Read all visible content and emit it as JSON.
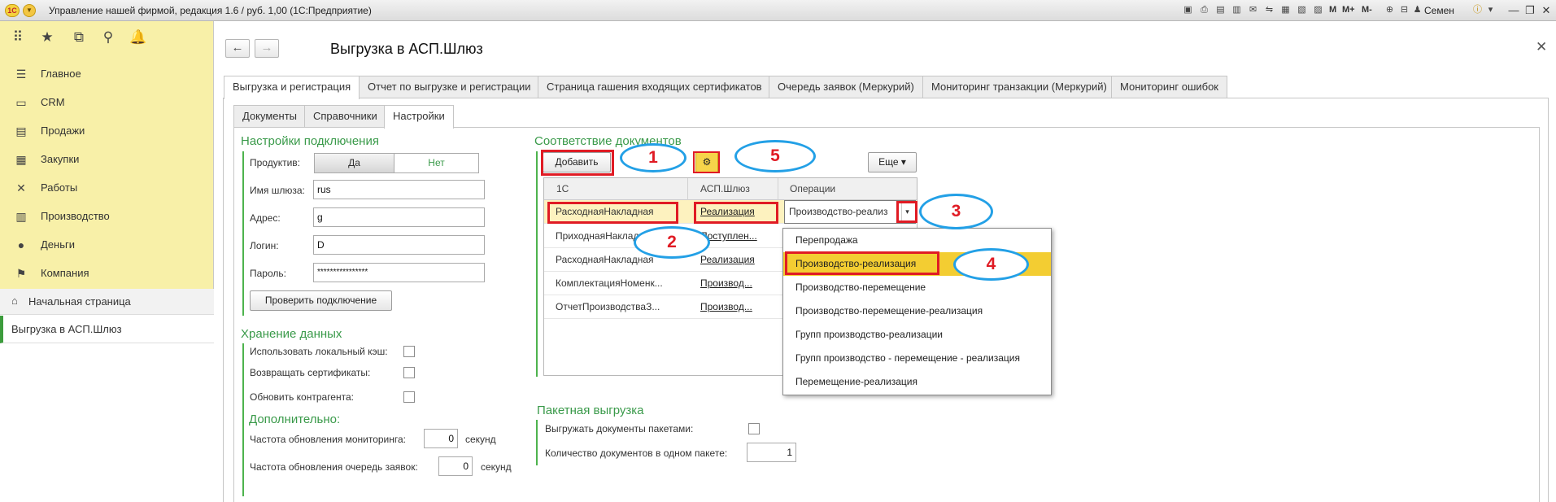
{
  "app": {
    "title": "Управление нашей фирмой, редакция 1.6 / руб. 1,00 (1С:Предприятие)",
    "logo": "1С",
    "user": "Семен",
    "toolbar": {
      "m": "M",
      "mplus": "M+",
      "mminus": "M-"
    }
  },
  "sidebar": {
    "items": [
      {
        "label": "Главное",
        "icon": "menu-lines-icon"
      },
      {
        "label": "CRM",
        "icon": "crm-icon"
      },
      {
        "label": "Продажи",
        "icon": "sales-icon"
      },
      {
        "label": "Закупки",
        "icon": "cart-icon"
      },
      {
        "label": "Работы",
        "icon": "tools-icon"
      },
      {
        "label": "Производство",
        "icon": "factory-icon"
      },
      {
        "label": "Деньги",
        "icon": "money-icon"
      },
      {
        "label": "Компания",
        "icon": "flag-icon"
      }
    ],
    "home": "Начальная страница",
    "current": "Выгрузка в АСП.Шлюз"
  },
  "page": {
    "title": "Выгрузка в АСП.Шлюз"
  },
  "tabs": [
    "Выгрузка и регистрация",
    "Отчет по выгрузке и регистрации",
    "Страница гашения входящих сертификатов",
    "Очередь заявок (Меркурий)",
    "Мониторинг транзакции (Меркурий)",
    "Мониторинг ошибок"
  ],
  "subtabs": [
    "Документы",
    "Справочники",
    "Настройки"
  ],
  "connection": {
    "header": "Настройки подключения",
    "productive_label": "Продуктив:",
    "yes": "Да",
    "no": "Нет",
    "gateway_label": "Имя шлюза:",
    "gateway": "rus",
    "address_label": "Адрес:",
    "address": "g",
    "login_label": "Логин:",
    "login": "D",
    "password_label": "Пароль:",
    "password": "****************",
    "check_button": "Проверить подключение"
  },
  "storage": {
    "header": "Хранение данных",
    "use_cache": "Использовать локальный кэш:",
    "return_certs": "Возвращать сертификаты:",
    "update_contractor": "Обновить контрагента:"
  },
  "additional": {
    "header": "Дополнительно:",
    "monitoring_freq": "Частота обновления мониторинга:",
    "monitoring_value": "0",
    "queue_freq": "Частота обновления очередь заявок:",
    "queue_value": "0",
    "unit": "секунд"
  },
  "mapping": {
    "header": "Соответствие документов",
    "add_button": "Добавить",
    "more_button": "Еще",
    "columns": [
      "1С",
      "АСП.Шлюз",
      "Операции"
    ],
    "rows": [
      {
        "c1": "РасходнаяНакладная",
        "c2": "Реализация",
        "c3": "Производство-реализ"
      },
      {
        "c1": "ПриходнаяНакладная",
        "c2": "Поступлен...",
        "c3": ""
      },
      {
        "c1": "РасходнаяНакладная",
        "c2": "Реализация",
        "c3": ""
      },
      {
        "c1": "КомплектацияНоменк...",
        "c2": "Производ...",
        "c3": ""
      },
      {
        "c1": "ОтчетПроизводстваЗ...",
        "c2": "Производ...",
        "c3": ""
      }
    ]
  },
  "dropdown": {
    "options": [
      "Перепродажа",
      "Производство-реализация",
      "Производство-перемещение",
      "Производство-перемещение-реализация",
      "Групп производство-реализации",
      "Групп производство - перемещение - реализация",
      "Перемещение-реализация"
    ]
  },
  "batch": {
    "header": "Пакетная выгрузка",
    "batch_label": "Выгружать документы пакетами:",
    "count_label": "Количество документов в одном пакете:",
    "count_value": "1"
  },
  "annotations": [
    "1",
    "2",
    "3",
    "4",
    "5"
  ]
}
